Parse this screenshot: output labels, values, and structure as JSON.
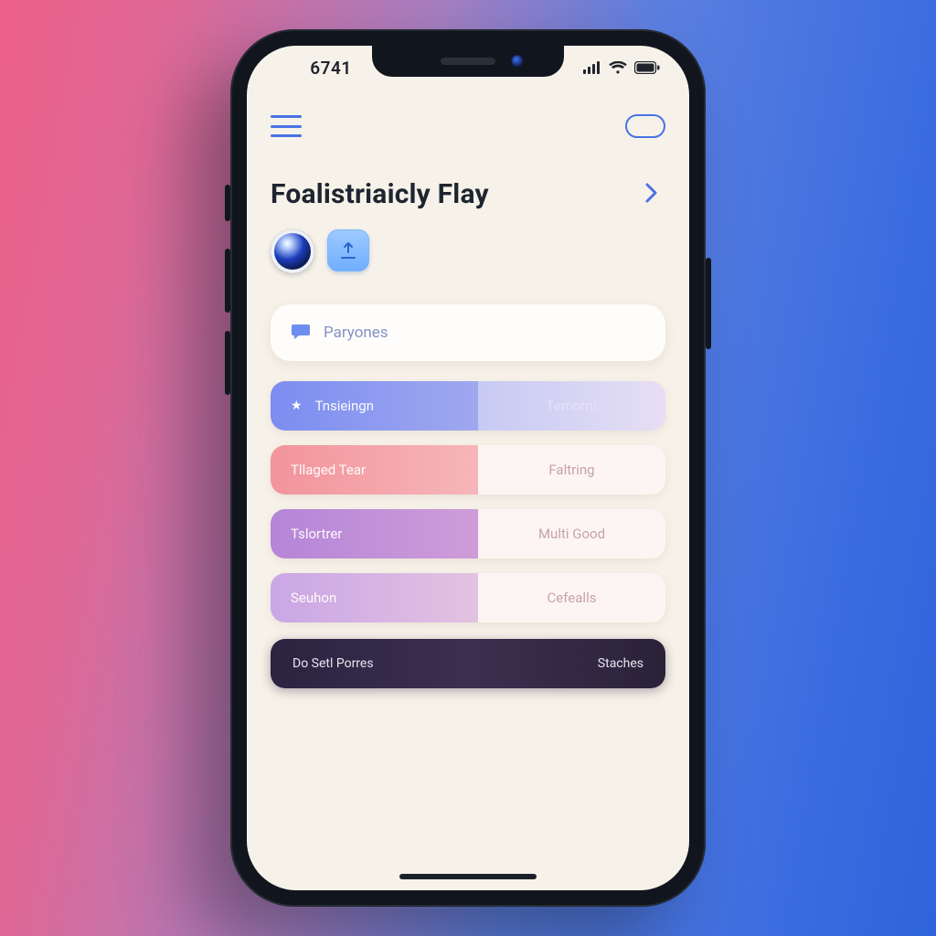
{
  "status": {
    "time": "6741"
  },
  "header": {
    "title": "Foalistriaicly Flay"
  },
  "card": {
    "label": "Paryones"
  },
  "segments": [
    {
      "left": "Tnsieingn",
      "right": "Temornt"
    },
    {
      "left": "Tllaged Tear",
      "right": "Faltring"
    },
    {
      "left": "Tslortrer",
      "right": "Multi Good"
    },
    {
      "left": "Seuhon",
      "right": "Cefealls"
    }
  ],
  "footer": {
    "left": "Do Setl Porres",
    "right": "Staches"
  }
}
